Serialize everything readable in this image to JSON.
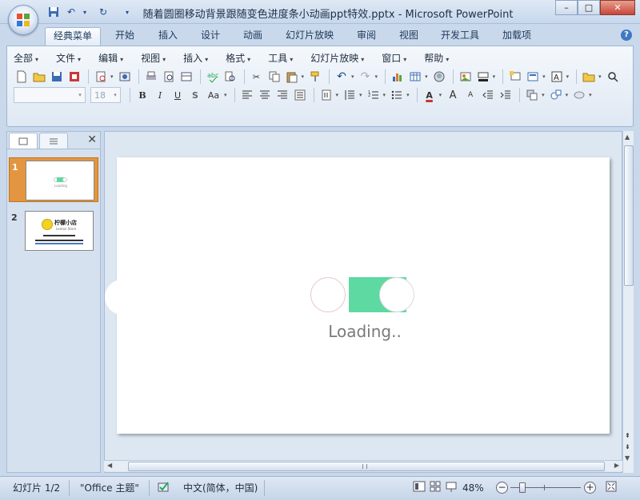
{
  "window": {
    "title": "随着圆圈移动背景跟随变色进度条小动画ppt特效.pptx - Microsoft PowerPoint",
    "minimize": "–",
    "maximize": "□",
    "close": "✕"
  },
  "ribbon_tabs": [
    "经典菜单",
    "开始",
    "插入",
    "设计",
    "动画",
    "幻灯片放映",
    "审阅",
    "视图",
    "开发工具",
    "加载项"
  ],
  "active_tab_index": 0,
  "help_label": "?",
  "menus": [
    "全部",
    "文件",
    "编辑",
    "视图",
    "插入",
    "格式",
    "工具",
    "幻灯片放映",
    "窗口",
    "帮助"
  ],
  "font_size": "18",
  "format_buttons": {
    "bold": "B",
    "italic": "I",
    "underline": "U",
    "shadow": "S",
    "case": "Aa",
    "font_color": "A",
    "grow": "A",
    "shrink": "A"
  },
  "panel": {
    "close": "✕",
    "slides": [
      {
        "num": "1",
        "thumb_text": "Loading"
      },
      {
        "num": "2",
        "thumb_text": "柠檬小店",
        "thumb_sub": "Lemon Store"
      }
    ]
  },
  "slide": {
    "loading_text": "Loading..",
    "accent": "#5ed9a1"
  },
  "status": {
    "slide_pos": "幻灯片 1/2",
    "theme": "\"Office 主题\"",
    "language": "中文(简体，中国)",
    "zoom": "48%"
  },
  "colors": {
    "selected_thumb": "#e39540",
    "ribbon_bg": "#dfe8f3"
  }
}
